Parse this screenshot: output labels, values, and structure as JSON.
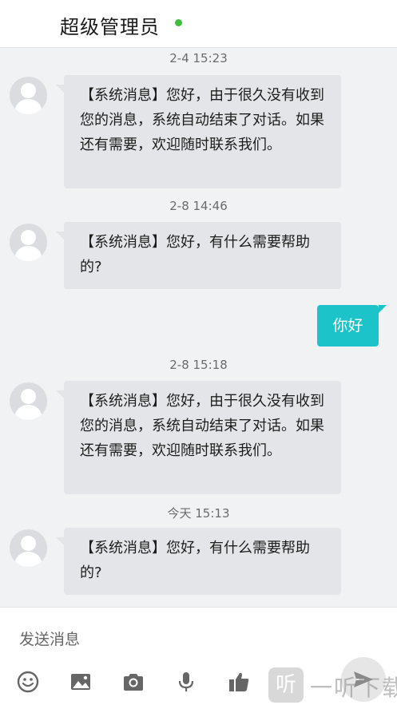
{
  "header": {
    "title": "超级管理员",
    "status_color": "#3cc03c"
  },
  "messages": [
    {
      "timestamp": "2-4 15:23",
      "sender": "system",
      "text": "【系统消息】您好，由于很久没有收到您的消息，系统自动结束了对话。如果还有需要，欢迎随时联系我们。"
    },
    {
      "timestamp": "2-8 14:46",
      "sender": "system",
      "text": "【系统消息】您好，有什么需要帮助的?"
    },
    {
      "sender": "me",
      "text": "你好"
    },
    {
      "timestamp": "2-8 15:18",
      "sender": "system",
      "text": "【系统消息】您好，由于很久没有收到您的消息，系统自动结束了对话。如果还有需要，欢迎随时联系我们。"
    },
    {
      "timestamp": "今天 15:13",
      "sender": "system",
      "text": "【系统消息】您好，有什么需要帮助的?"
    }
  ],
  "input": {
    "placeholder": "发送消息"
  },
  "toolbar": {
    "icons": [
      "emoji-icon",
      "image-icon",
      "camera-icon",
      "microphone-icon",
      "thumbs-up-icon",
      "send-icon"
    ]
  },
  "colors": {
    "accent": "#1cc4c9",
    "incoming_bubble": "#e3e5e8",
    "background": "#f1f2f4"
  },
  "watermark": {
    "logo": "听",
    "text": "一听下载"
  }
}
